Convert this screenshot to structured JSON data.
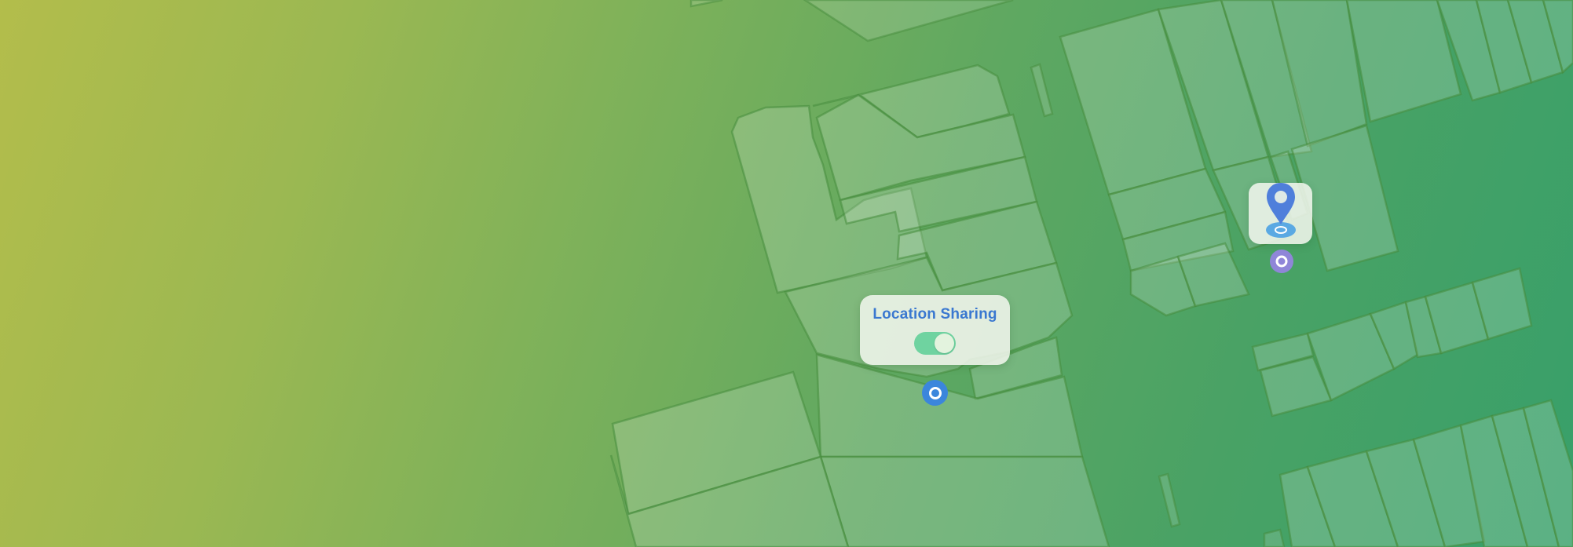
{
  "location_sharing": {
    "title": "Location Sharing",
    "toggle_on": true
  },
  "colors": {
    "title_text": "#3a78d0",
    "toggle_track": "#6fd3a0",
    "user_marker": "#3b86dc",
    "friend_marker": "#8f86d8",
    "pin": "#4f7fdb",
    "pin_base": "#5aa9e3"
  },
  "icons": {
    "pin": "map-pin-icon",
    "user_location": "current-location-icon",
    "friend_location": "friend-location-icon",
    "toggle": "toggle-switch"
  }
}
